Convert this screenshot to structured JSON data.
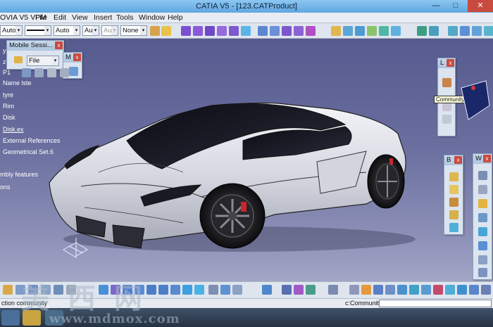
{
  "window": {
    "title": "CATIA V5 - [123.CATProduct]",
    "min": "—",
    "max": "□",
    "close": "✕"
  },
  "menu": {
    "items": [
      "OVIA V5 VPM",
      "File",
      "Edit",
      "View",
      "Insert",
      "Tools",
      "Window",
      "Help"
    ]
  },
  "toolbar": {
    "combo1": "Auto",
    "combo2": "Auto",
    "combo3": "Aut",
    "combo4": "Aut",
    "combo5": "None",
    "arrow": "▾"
  },
  "tree": {
    "items": [
      {
        "label": "y"
      },
      {
        "label": "z"
      },
      {
        "label": "P1"
      },
      {
        "label": "Name lste"
      },
      {
        "label": "tyre"
      },
      {
        "label": "Rim"
      },
      {
        "label": "Disk"
      },
      {
        "label": "Disk.ex"
      },
      {
        "label": "External References"
      },
      {
        "label": "Geometrical Set.6"
      },
      {
        "label": "mbly features"
      },
      {
        "label": "ons"
      }
    ]
  },
  "mobile_session": {
    "title": "Mobile Sessi...",
    "file_value": "File",
    "close": "x"
  },
  "small_panel": {
    "title": "M",
    "close": "x"
  },
  "panel_L": {
    "title": "L",
    "close": "x"
  },
  "panel_B": {
    "title": "B",
    "close": "x"
  },
  "panel_W": {
    "title": "W",
    "close": "x"
  },
  "tooltip": "Community",
  "status": {
    "left": "ction community",
    "right": "c:Community"
  },
  "watermark": {
    "chars": "美 西 网",
    "url": "www.mdmox.com"
  },
  "colors": {
    "title_bar": "#6eb1e6",
    "viewport_top": "#565a8e",
    "viewport_bottom": "#a2a6c6",
    "close_red": "#c94a3e"
  }
}
